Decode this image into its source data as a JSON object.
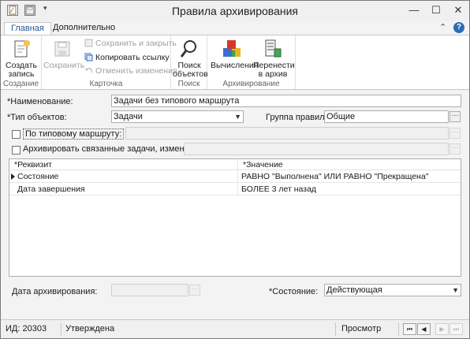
{
  "window": {
    "title": "Правила архивирования",
    "minimize_glyph": "—",
    "maximize_glyph": "☐",
    "close_glyph": "✕"
  },
  "ribbon_tabs": {
    "active": "Главная",
    "other": "Дополнительно",
    "collapse_glyph": "⌃",
    "help_glyph": "?"
  },
  "ribbon": {
    "groups": {
      "create": "Создание",
      "card": "Карточка",
      "search": "Поиск",
      "archive": "Архивирование"
    },
    "buttons": {
      "create_line1": "Создать",
      "create_line2": "запись",
      "save": "Сохранить",
      "save_close": "Сохранить и закрыть",
      "copy_link": "Копировать ссылку",
      "undo_changes": "Отменить изменения",
      "search_line1": "Поиск",
      "search_line2": "объектов",
      "compute": "Вычисления",
      "move_line1": "Перенести",
      "move_line2": "в архив"
    }
  },
  "form": {
    "name_label": "*Наименование:",
    "name_value": "Задачи без типового маршрута",
    "type_label": "*Тип объектов:",
    "type_value": "Задачи",
    "group_label": "Группа правил:",
    "group_value": "Общие",
    "route_label": "По типовому маршруту:",
    "related_label": "Архивировать связанные задачи, измененные",
    "ellipsis": "···",
    "archive_date_label": "Дата архивирования:",
    "state_label": "*Состояние:",
    "state_value": "Действующая"
  },
  "grid": {
    "col_attr": "*Реквизит",
    "col_value": "*Значение",
    "rows": [
      {
        "attr": "Состояние",
        "value": "РАВНО \"Выполнена\" ИЛИ РАВНО \"Прекращена\""
      },
      {
        "attr": "Дата завершения",
        "value": "БОЛЕЕ 3 лет назад"
      }
    ]
  },
  "status": {
    "id": "ИД: 20303",
    "approval": "Утверждена",
    "mode": "Просмотр",
    "nav_first": "⏮",
    "nav_prev": "◀",
    "nav_next": "▶",
    "nav_last": "⏭"
  },
  "colors": {
    "accent": "#2b579a",
    "ribbon_bg": "#ffffff",
    "window_bg": "#f3f3f3"
  }
}
